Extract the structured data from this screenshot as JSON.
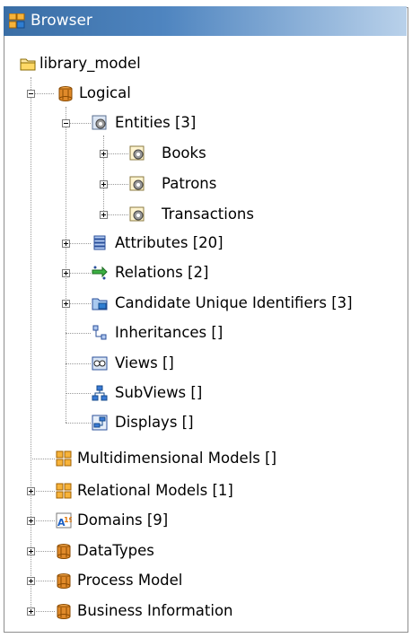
{
  "panel": {
    "title": "Browser",
    "title_icon": "browser-icon"
  },
  "tree": [
    {
      "label": "library_model",
      "icon": "folder-icon"
    },
    {
      "label": "Logical",
      "icon": "package-icon"
    },
    {
      "label": "Entities [3]",
      "icon": "entity-folder-icon"
    },
    {
      "label": "Books",
      "icon": "entity-icon"
    },
    {
      "label": "Patrons",
      "icon": "entity-icon"
    },
    {
      "label": "Transactions",
      "icon": "entity-icon"
    },
    {
      "label": "Attributes [20]",
      "icon": "attributes-icon"
    },
    {
      "label": "Relations [2]",
      "icon": "relations-icon"
    },
    {
      "label": "Candidate Unique Identifiers [3]",
      "icon": "identifiers-icon"
    },
    {
      "label": "Inheritances []",
      "icon": "inheritance-icon"
    },
    {
      "label": "Views []",
      "icon": "views-icon"
    },
    {
      "label": "SubViews []",
      "icon": "subviews-icon"
    },
    {
      "label": "Displays []",
      "icon": "displays-icon"
    },
    {
      "label": "Multidimensional Models []",
      "icon": "grid-icon"
    },
    {
      "label": "Relational Models [1]",
      "icon": "grid-icon"
    },
    {
      "label": "Domains [9]",
      "icon": "domains-icon"
    },
    {
      "label": "DataTypes",
      "icon": "package-icon"
    },
    {
      "label": "Process Model",
      "icon": "package-icon"
    },
    {
      "label": "Business Information",
      "icon": "package-icon"
    }
  ]
}
